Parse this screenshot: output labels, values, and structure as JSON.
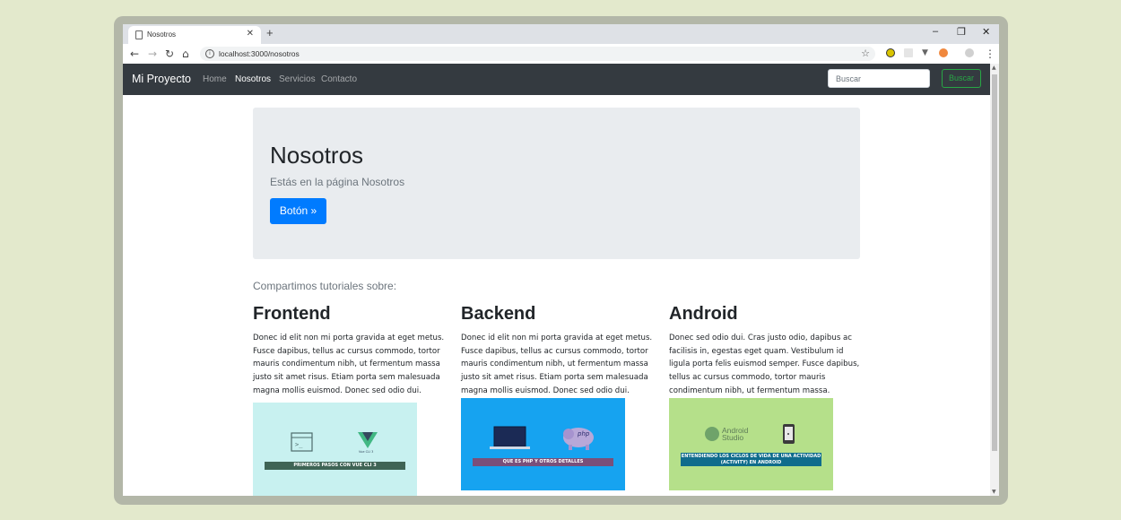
{
  "browser": {
    "tab_title": "Nosotros",
    "tab_close": "✕",
    "new_tab": "+",
    "url": "localhost:3000/nosotros",
    "controls": {
      "minimize": "–",
      "maximize": "❐",
      "close": "✕"
    },
    "nav": {
      "back": "←",
      "forward": "→",
      "reload": "↻",
      "home": "⌂"
    },
    "star": "☆",
    "menu": "⋮"
  },
  "site_nav": {
    "brand": "Mi Proyecto",
    "links": [
      "Home",
      "Nosotros",
      "Servicios",
      "Contacto"
    ],
    "search_placeholder": "Buscar",
    "search_button": "Buscar",
    "colors": {
      "background": "#343a40",
      "search_button": "#28a745"
    }
  },
  "jumbotron": {
    "title": "Nosotros",
    "lead": "Estás en la página Nosotros",
    "button": "Botón »",
    "colors": {
      "background": "#e9ecef",
      "button": "#007bff"
    }
  },
  "tutorials": {
    "lead": "Compartimos tutoriales sobre:",
    "columns": [
      {
        "title": "Frontend",
        "text": "Donec id elit non mi porta gravida at eget metus. Fusce dapibus, tellus ac cursus commodo, tortor mauris condimentum nibh, ut fermentum massa justo sit amet risus. Etiam porta sem malesuada magna mollis euismod. Donec sed odio dui.",
        "image_caption": "PRIMEROS PASOS CON VUE CLI 3",
        "image_sub": "Vue CLI 3",
        "image_bg": "#c8f1f0"
      },
      {
        "title": "Backend",
        "text": "Donec id elit non mi porta gravida at eget metus. Fusce dapibus, tellus ac cursus commodo, tortor mauris condimentum nibh, ut fermentum massa justo sit amet risus. Etiam porta sem malesuada magna mollis euismod. Donec sed odio dui.",
        "image_caption": "QUE ES PHP Y OTROS DETALLES",
        "image_sub": "php",
        "image_bg": "#16a3f0"
      },
      {
        "title": "Android",
        "text": "Donec sed odio dui. Cras justo odio, dapibus ac facilisis in, egestas eget quam. Vestibulum id ligula porta felis euismod semper. Fusce dapibus, tellus ac cursus commodo, tortor mauris condimentum nibh, ut fermentum massa.",
        "image_caption": "ENTENDIENDO LOS CICLOS DE VIDA DE UNA ACTIVIDAD (ACTIVITY) EN ANDROID",
        "image_sub": "Android Studio",
        "image_bg": "#b5e08a"
      }
    ]
  }
}
